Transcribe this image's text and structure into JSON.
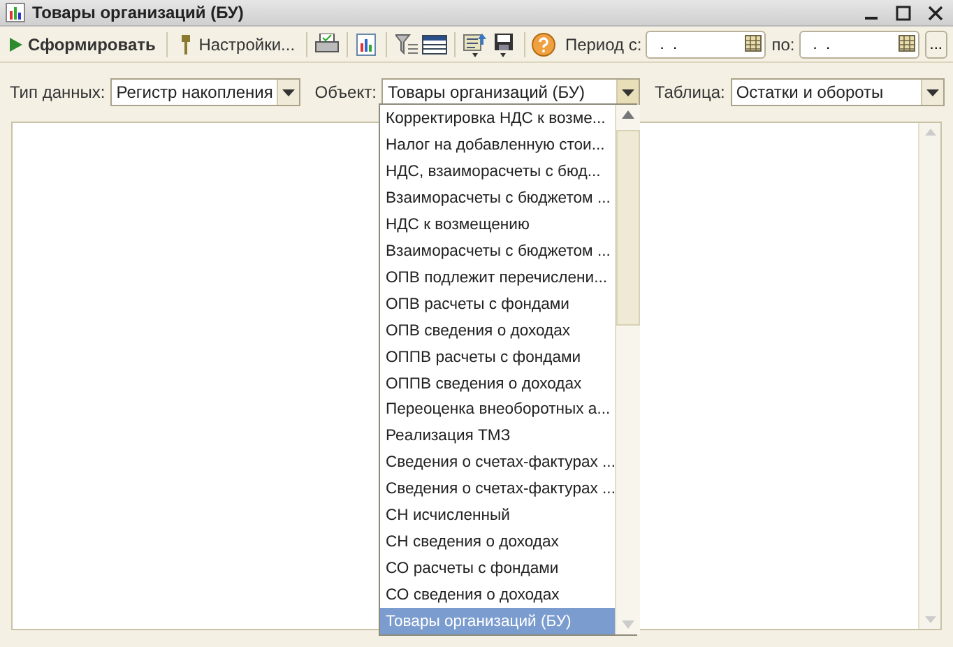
{
  "window": {
    "title": "Товары организаций (БУ)"
  },
  "toolbar": {
    "generate": "Сформировать",
    "settings": "Настройки...",
    "period_from_label": "Период с:",
    "period_from": " .  .",
    "period_to_label": "по:",
    "period_to": " .  .",
    "more": "..."
  },
  "filters": [
    {
      "label": "Тип данных:",
      "value": "Регистр накопления",
      "open": false
    },
    {
      "label": "Объект:",
      "value": "Товары организаций (БУ)",
      "open": true
    },
    {
      "label": "Таблица:",
      "value": "Остатки и обороты",
      "open": false
    }
  ],
  "dropdown": {
    "items": [
      {
        "label": "Корректировка НДС к возме...",
        "selected": false
      },
      {
        "label": "Налог на добавленную стои...",
        "selected": false
      },
      {
        "label": "НДС, взаиморасчеты с бюд...",
        "selected": false
      },
      {
        "label": "Взаиморасчеты с бюджетом ...",
        "selected": false
      },
      {
        "label": "НДС к возмещению",
        "selected": false
      },
      {
        "label": "Взаиморасчеты с бюджетом ...",
        "selected": false
      },
      {
        "label": "ОПВ подлежит перечислени...",
        "selected": false
      },
      {
        "label": "ОПВ расчеты с фондами",
        "selected": false
      },
      {
        "label": "ОПВ сведения о доходах",
        "selected": false
      },
      {
        "label": "ОППВ расчеты с фондами",
        "selected": false
      },
      {
        "label": "ОППВ сведения о доходах",
        "selected": false
      },
      {
        "label": "Переоценка внеоборотных а...",
        "selected": false
      },
      {
        "label": "Реализация ТМЗ",
        "selected": false
      },
      {
        "label": "Сведения о счетах-фактурах ...",
        "selected": false
      },
      {
        "label": "Сведения о счетах-фактурах ...",
        "selected": false
      },
      {
        "label": "СН исчисленный",
        "selected": false
      },
      {
        "label": "СН сведения о доходах",
        "selected": false
      },
      {
        "label": "СО расчеты с фондами",
        "selected": false
      },
      {
        "label": "СО сведения о доходах",
        "selected": false
      },
      {
        "label": "Товары организаций (БУ)",
        "selected": true
      }
    ]
  }
}
